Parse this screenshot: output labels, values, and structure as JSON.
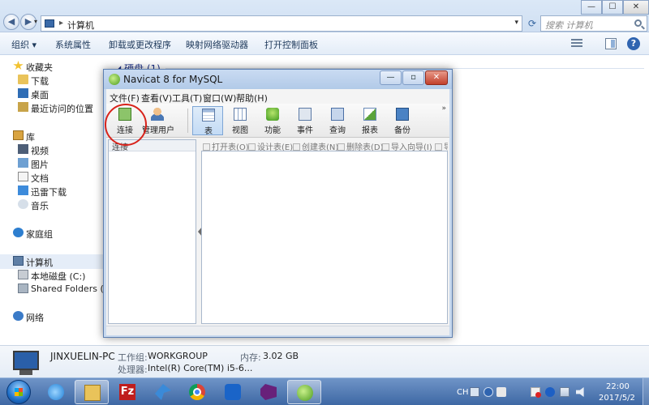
{
  "explorer": {
    "address": "计算机",
    "search_placeholder": "搜索 计算机",
    "window_controls": {
      "minimize": "—",
      "maximize": "☐",
      "close": "✕"
    },
    "commands": [
      "组织 ▾",
      "系统属性",
      "卸载或更改程序",
      "映射网络驱动器",
      "打开控制面板"
    ],
    "nav": {
      "favorites": "收藏夹",
      "favorites_items": [
        "下载",
        "桌面",
        "最近访问的位置"
      ],
      "library": "库",
      "library_items": [
        "视频",
        "图片",
        "文档",
        "迅雷下载",
        "音乐"
      ],
      "homegroup": "家庭组",
      "computer": "计算机",
      "computer_items": [
        "本地磁盘 (C:)",
        "Shared Folders (\\\\v"
      ],
      "network": "网络"
    },
    "content": {
      "group_header": "◢ 硬盘 (1)"
    },
    "details": {
      "pc_name": "JINXUELIN-PC",
      "workgroup_label": "工作组:",
      "workgroup": "WORKGROUP",
      "memory_label": "内存:",
      "memory": "3.02 GB",
      "cpu_label": "处理器:",
      "cpu": "Intel(R) Core(TM) i5-6..."
    }
  },
  "navicat": {
    "title": "Navicat 8 for MySQL",
    "controls": {
      "minimize": "—",
      "maximize": "▫",
      "close": "✕"
    },
    "menu": [
      "文件(F)",
      "查看(V)",
      "工具(T)",
      "窗口(W)",
      "帮助(H)"
    ],
    "toolbar": [
      "连接",
      "管理用户",
      "表",
      "视图",
      "功能",
      "事件",
      "查询",
      "报表",
      "备份"
    ],
    "toolbar_more": "»",
    "left_header": "连接",
    "object_toolbar": [
      "打开表(O)",
      "设计表(E)",
      "创建表(N)",
      "删除表(D)",
      "导入向导(I)",
      "导"
    ]
  },
  "taskbar": {
    "lang": "CH",
    "time": "22:00",
    "date": "2017/5/2"
  }
}
